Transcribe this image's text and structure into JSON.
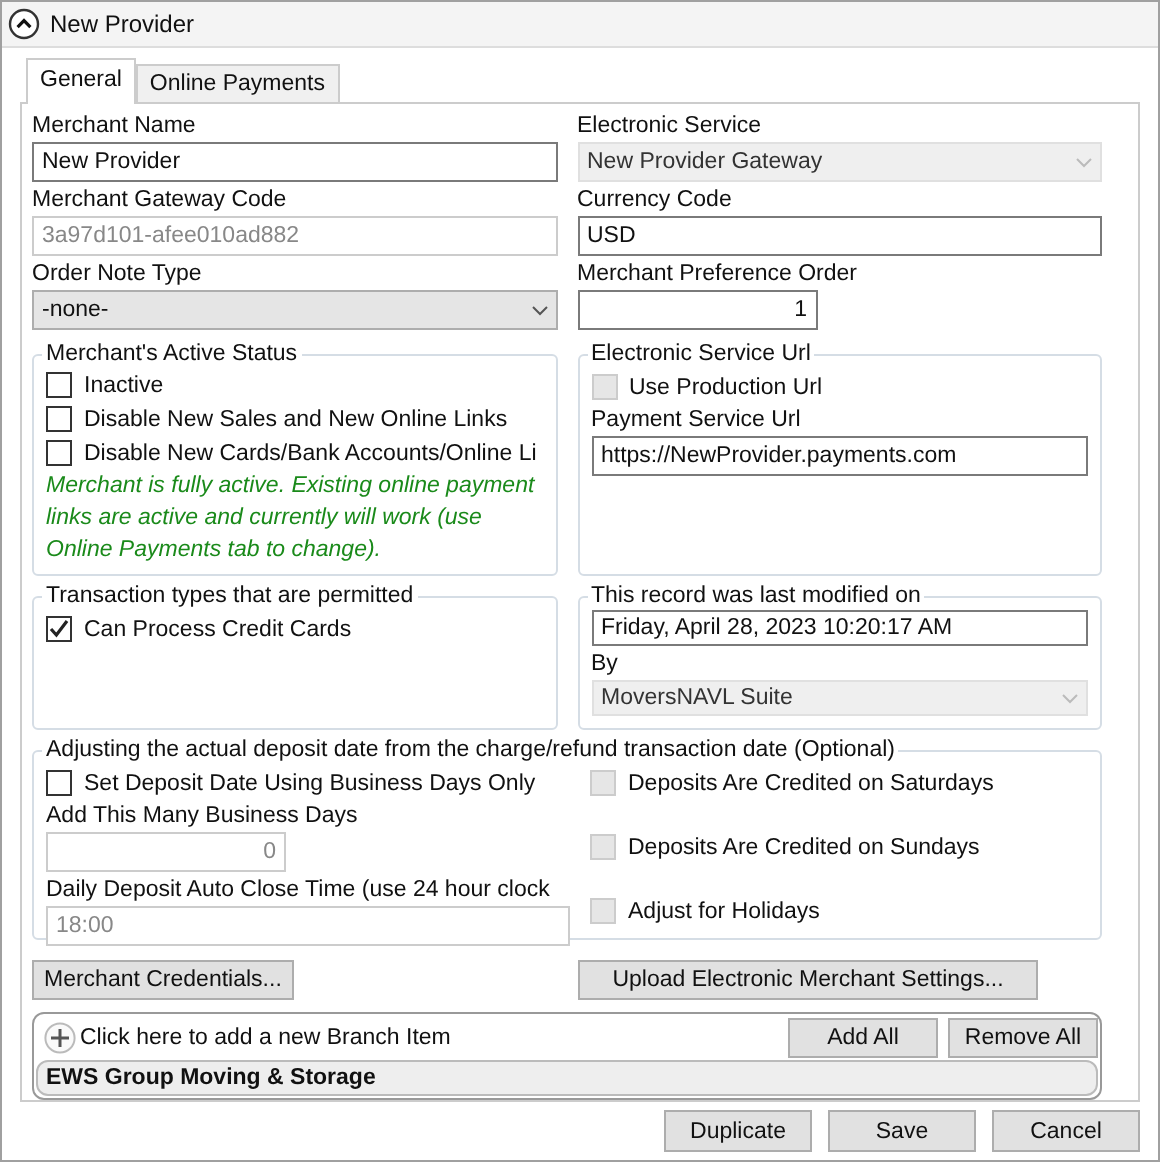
{
  "window": {
    "title": "New Provider"
  },
  "tabs": [
    {
      "label": "General",
      "selected": true
    },
    {
      "label": "Online Payments",
      "selected": false
    }
  ],
  "left_fields": [
    {
      "label": "Merchant Name",
      "kind": "text",
      "value": "New Provider",
      "disabled": false
    },
    {
      "label": "Merchant Gateway Code",
      "kind": "text",
      "value": "3a97d101-afee010ad882",
      "disabled": true
    },
    {
      "label": "Order Note Type",
      "kind": "select",
      "value": "-none-",
      "disabled": false
    }
  ],
  "right_fields": [
    {
      "label": "Electronic Service",
      "kind": "select",
      "value": "New Provider Gateway",
      "disabled": true
    },
    {
      "label": "Currency Code",
      "kind": "text",
      "value": "USD",
      "disabled": false
    },
    {
      "label": "Merchant Preference Order",
      "kind": "number",
      "value": "1",
      "disabled": false
    }
  ],
  "active_status": {
    "title": "Merchant's Active Status",
    "checkboxes": [
      {
        "label": "Inactive",
        "checked": false,
        "disabled": false
      },
      {
        "label": "Disable New Sales and New Online Links",
        "checked": false,
        "disabled": false
      },
      {
        "label": "Disable New Cards/Bank Accounts/Online Li",
        "checked": false,
        "disabled": false
      }
    ],
    "note": "Merchant is fully active.  Existing online payment links are active and currently will work (use Online Payments tab to change)."
  },
  "service_url": {
    "title": "Electronic Service Url",
    "checkbox": {
      "label": "Use Production Url",
      "checked": false,
      "disabled": true
    },
    "field_label": "Payment Service Url",
    "field_value": "https://NewProvider.payments.com"
  },
  "transaction_types": {
    "title": "Transaction types that are permitted",
    "checkboxes": [
      {
        "label": "Can Process Credit Cards",
        "checked": true,
        "disabled": false
      }
    ]
  },
  "last_modified": {
    "title": "This record was last modified on",
    "value": "Friday, April 28, 2023 10:20:17 AM",
    "by_label": "By",
    "by_value": "MoversNAVL Suite"
  },
  "deposit": {
    "title": "Adjusting the actual deposit date from the charge/refund transaction date (Optional)",
    "checkbox": {
      "label": "Set Deposit Date Using Business Days Only",
      "checked": false,
      "disabled": false
    },
    "fields": [
      {
        "label": "Add This Many Business Days",
        "kind": "number",
        "value": "0",
        "disabled": true
      },
      {
        "label": "Daily Deposit Auto Close Time (use 24 hour clock",
        "kind": "text",
        "value": "18:00",
        "disabled": true
      }
    ],
    "options": [
      {
        "label": "Deposits Are Credited on Saturdays",
        "checked": false,
        "disabled": true
      },
      {
        "label": "Deposits Are Credited on Sundays",
        "checked": false,
        "disabled": true
      },
      {
        "label": "Adjust for Holidays",
        "checked": false,
        "disabled": true
      }
    ]
  },
  "action_buttons": [
    "Merchant Credentials...",
    "Upload Electronic Merchant Settings..."
  ],
  "branches": {
    "add_link": "Click here to add a new Branch Item",
    "buttons": [
      "Add All",
      "Remove All"
    ],
    "items": [
      "EWS Group Moving & Storage"
    ]
  },
  "footer_buttons": [
    "Duplicate",
    "Save",
    "Cancel"
  ]
}
